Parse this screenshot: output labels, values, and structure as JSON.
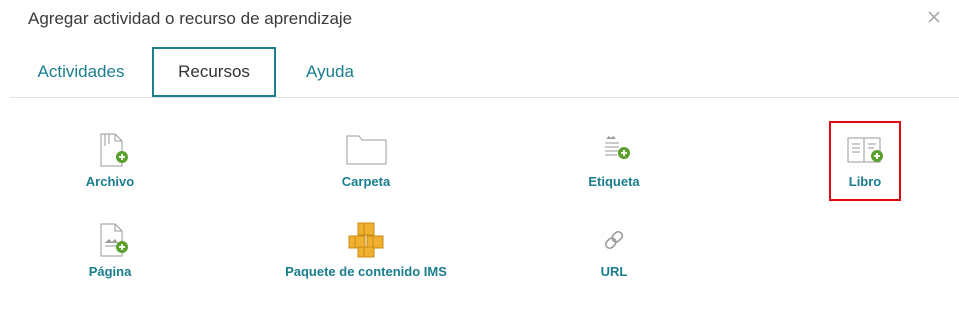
{
  "dialog": {
    "title": "Agregar actividad o recurso de aprendizaje",
    "close_icon": "close-icon"
  },
  "tabs": [
    {
      "label": "Actividades",
      "active": false
    },
    {
      "label": "Recursos",
      "active": true
    },
    {
      "label": "Ayuda",
      "active": false
    }
  ],
  "resources": [
    {
      "label": "Archivo",
      "icon": "file-icon"
    },
    {
      "label": "Carpeta",
      "icon": "folder-icon"
    },
    {
      "label": "Etiqueta",
      "icon": "label-icon"
    },
    {
      "label": "Libro",
      "icon": "book-icon",
      "highlighted": true
    },
    {
      "label": "Página",
      "icon": "page-icon"
    },
    {
      "label": "Paquete de contenido IMS",
      "icon": "ims-package-icon"
    },
    {
      "label": "URL",
      "icon": "url-icon"
    }
  ],
  "colors": {
    "accent": "#1a7d8d",
    "plus_badge": "#5aa02c",
    "highlight_border": "#e30613"
  }
}
